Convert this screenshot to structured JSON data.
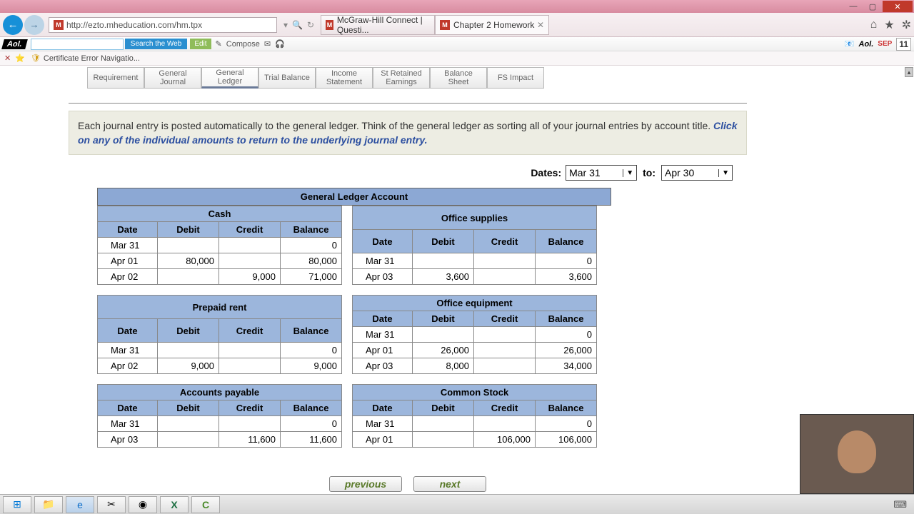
{
  "window": {
    "minimize": "—",
    "maximize": "▢",
    "close": "✕"
  },
  "browser": {
    "url": "http://ezto.mheducation.com/hm.tpx",
    "tabs": [
      {
        "label": "McGraw-Hill Connect | Questi...",
        "favicon": "M"
      },
      {
        "label": "Chapter 2 Homework",
        "favicon": "M"
      }
    ],
    "icons": {
      "home": "⌂",
      "star": "★",
      "gear": "✲"
    }
  },
  "aol": {
    "search_btn": "Search the Web",
    "edit": "Edit",
    "compose": "Compose",
    "logo": "Aol.",
    "date_month": "SEP",
    "date_day": "11"
  },
  "notice": {
    "text": "Certificate Error Navigatio..."
  },
  "navtabs": [
    "Requirement",
    "General\nJournal",
    "General\nLedger",
    "Trial Balance",
    "Income\nStatement",
    "St Retained\nEarnings",
    "Balance\nSheet",
    "FS Impact"
  ],
  "instructions": {
    "text1": "Each journal entry is posted automatically to the general ledger.   Think of the general ledger as sorting all of your journal entries by account title.  ",
    "link": "Click on any of the individual amounts to return to the underlying journal entry."
  },
  "dates": {
    "label": "Dates:",
    "from": "Mar 31",
    "to_label": "to:",
    "to": "Apr 30"
  },
  "ledger_header": "General Ledger Account",
  "col_headers": {
    "date": "Date",
    "debit": "Debit",
    "credit": "Credit",
    "balance": "Balance"
  },
  "accounts": {
    "cash": {
      "title": "Cash",
      "rows": [
        {
          "date": "Mar 31",
          "debit": "",
          "credit": "",
          "balance": "0"
        },
        {
          "date": "Apr 01",
          "debit": "80,000",
          "credit": "",
          "balance": "80,000"
        },
        {
          "date": "Apr 02",
          "debit": "",
          "credit": "9,000",
          "balance": "71,000"
        }
      ]
    },
    "office_supplies": {
      "title": "Office supplies",
      "rows": [
        {
          "date": "Mar 31",
          "debit": "",
          "credit": "",
          "balance": "0"
        },
        {
          "date": "Apr 03",
          "debit": "3,600",
          "credit": "",
          "balance": "3,600"
        }
      ]
    },
    "prepaid_rent": {
      "title": "Prepaid rent",
      "rows": [
        {
          "date": "Mar 31",
          "debit": "",
          "credit": "",
          "balance": "0"
        },
        {
          "date": "Apr 02",
          "debit": "9,000",
          "credit": "",
          "balance": "9,000"
        }
      ]
    },
    "office_equipment": {
      "title": "Office equipment",
      "rows": [
        {
          "date": "Mar 31",
          "debit": "",
          "credit": "",
          "balance": "0"
        },
        {
          "date": "Apr 01",
          "debit": "26,000",
          "credit": "",
          "balance": "26,000"
        },
        {
          "date": "Apr 03",
          "debit": "8,000",
          "credit": "",
          "balance": "34,000"
        }
      ]
    },
    "accounts_payable": {
      "title": "Accounts payable",
      "rows": [
        {
          "date": "Mar 31",
          "debit": "",
          "credit": "",
          "balance": "0"
        },
        {
          "date": "Apr 03",
          "debit": "",
          "credit": "11,600",
          "balance": "11,600"
        }
      ]
    },
    "common_stock": {
      "title": "Common Stock",
      "rows": [
        {
          "date": "Mar 31",
          "debit": "",
          "credit": "",
          "balance": "0"
        },
        {
          "date": "Apr 01",
          "debit": "",
          "credit": "106,000",
          "balance": "106,000"
        }
      ]
    }
  },
  "pager": {
    "prev": "previous",
    "next": "next"
  }
}
